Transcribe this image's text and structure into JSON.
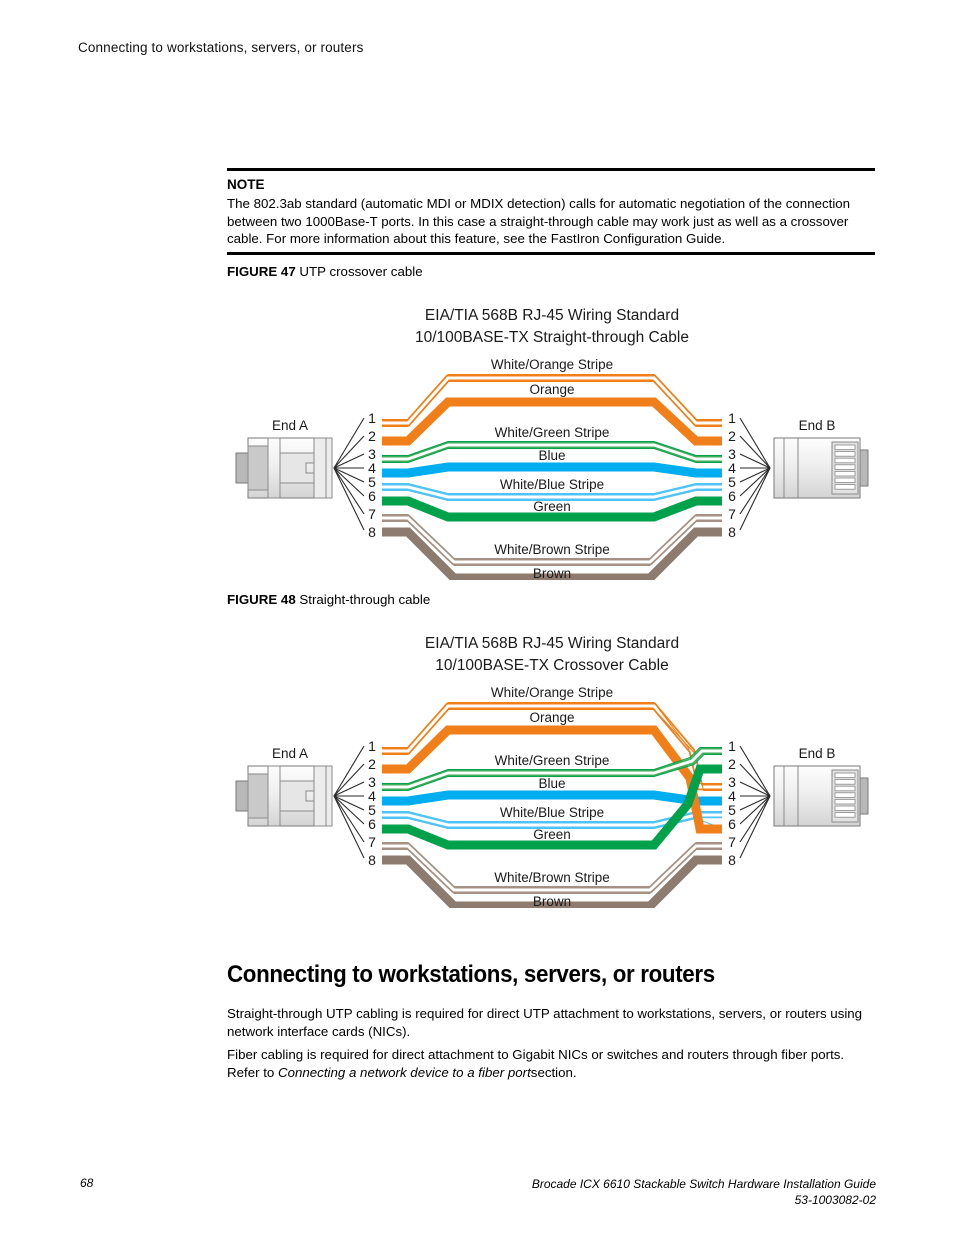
{
  "page": {
    "running_header": "Connecting to workstations, servers, or routers",
    "footer_page_number": "68",
    "footer_title": "Brocade ICX 6610 Stackable Switch Hardware Installation Guide",
    "footer_doc_number": "53-1003082-02"
  },
  "note": {
    "title": "NOTE",
    "text": "The 802.3ab standard (automatic MDI or MDIX detection) calls for automatic negotiation of the connection between two 1000Base-T ports. In this case a straight-through cable may work just as well as a crossover cable. For more information about this feature, see the FastIron Configuration Guide."
  },
  "figures": [
    {
      "label": "FIGURE 47",
      "caption": "UTP crossover cable",
      "title_line1": "EIA/TIA 568B RJ-45 Wiring Standard",
      "title_line2": "10/100BASE-TX Straight-through Cable",
      "end_a_label": "End A",
      "end_b_label": "End B",
      "pins": [
        "1",
        "2",
        "3",
        "4",
        "5",
        "6",
        "7",
        "8"
      ],
      "wire_labels": [
        "White/Orange Stripe",
        "Orange",
        "White/Green Stripe",
        "Blue",
        "White/Blue Stripe",
        "Green",
        "White/Brown Stripe",
        "Brown"
      ]
    },
    {
      "label": "FIGURE 48",
      "caption": "Straight-through cable",
      "title_line1": "EIA/TIA 568B RJ-45 Wiring Standard",
      "title_line2": "10/100BASE-TX Crossover Cable",
      "end_a_label": "End A",
      "end_b_label": "End B",
      "pins": [
        "1",
        "2",
        "3",
        "4",
        "5",
        "6",
        "7",
        "8"
      ],
      "wire_labels": [
        "White/Orange Stripe",
        "Orange",
        "White/Green Stripe",
        "Blue",
        "White/Blue Stripe",
        "Green",
        "White/Brown Stripe",
        "Brown"
      ]
    }
  ],
  "section": {
    "heading": "Connecting to workstations, servers, or routers",
    "paragraph_1": "Straight-through UTP cabling is required for direct UTP attachment to workstations, servers, or routers using network interface cards (NICs).",
    "paragraph_2_before": "Fiber cabling is required for direct attachment to Gigabit NICs or switches and routers through fiber ports. Refer to ",
    "paragraph_2_italic": "Connecting a network device to a fiber port",
    "paragraph_2_after": "section."
  },
  "chart_data": {
    "type": "diagram",
    "title": "EIA/TIA 568B RJ-45 wiring diagrams",
    "colors": {
      "orange": "#F07F1A",
      "orange_stripe": "#F07F1A",
      "green": "#00A14B",
      "green_stripe": "#3FAE5A",
      "blue": "#00AEEF",
      "blue_stripe": "#4FC3F7",
      "brown": "#8C7B6E",
      "brown_stripe": "#A59183",
      "connector_body": "#E8E8E8",
      "connector_outline": "#808080"
    },
    "diagrams": [
      {
        "name": "straight-through",
        "title": "10/100BASE-TX Straight-through Cable",
        "end_a_pinout": [
          "White/Orange Stripe",
          "Orange",
          "White/Green Stripe",
          "Blue",
          "White/Blue Stripe",
          "Green",
          "White/Brown Stripe",
          "Brown"
        ],
        "end_b_pinout": [
          "White/Orange Stripe",
          "Orange",
          "White/Green Stripe",
          "Blue",
          "White/Blue Stripe",
          "Green",
          "White/Brown Stripe",
          "Brown"
        ],
        "mapping": [
          [
            1,
            1
          ],
          [
            2,
            2
          ],
          [
            3,
            3
          ],
          [
            4,
            4
          ],
          [
            5,
            5
          ],
          [
            6,
            6
          ],
          [
            7,
            7
          ],
          [
            8,
            8
          ]
        ]
      },
      {
        "name": "crossover",
        "title": "10/100BASE-TX Crossover Cable",
        "end_a_pinout": [
          "White/Orange Stripe",
          "Orange",
          "White/Green Stripe",
          "Blue",
          "White/Blue Stripe",
          "Green",
          "White/Brown Stripe",
          "Brown"
        ],
        "end_b_pinout": [
          "White/Green Stripe",
          "Green",
          "White/Orange Stripe",
          "Blue",
          "White/Blue Stripe",
          "Orange",
          "White/Brown Stripe",
          "Brown"
        ],
        "mapping": [
          [
            1,
            3
          ],
          [
            2,
            6
          ],
          [
            3,
            1
          ],
          [
            4,
            4
          ],
          [
            5,
            5
          ],
          [
            6,
            2
          ],
          [
            7,
            7
          ],
          [
            8,
            8
          ]
        ]
      }
    ]
  }
}
